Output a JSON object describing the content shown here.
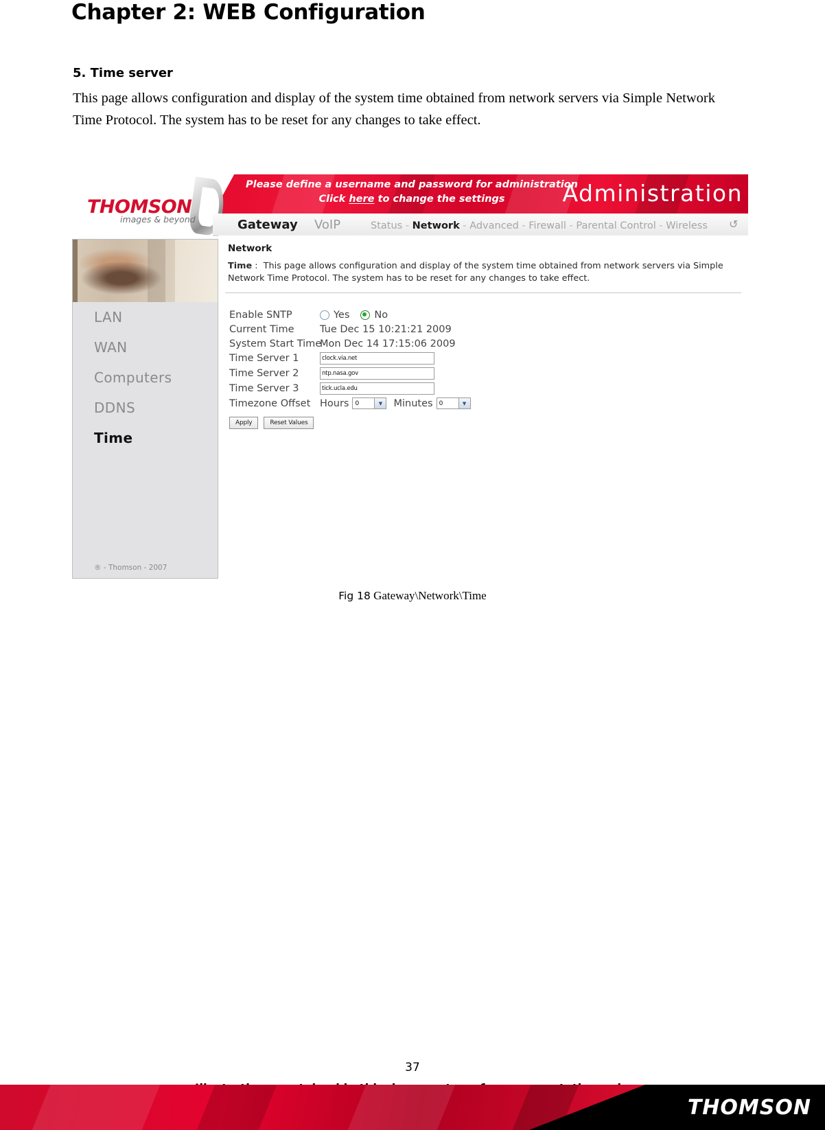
{
  "document": {
    "chapter_title": "Chapter 2: WEB Configuration",
    "section_heading": "5. Time server",
    "body_paragraph": "This page allows configuration and display of the system time obtained from network servers via Simple Network Time Protocol. The system has to be reset for any changes to take effect.",
    "figure_label": "Fig 18",
    "figure_caption": "Gateway\\Network\\Time",
    "page_number": "37",
    "footer_note": "Illustrations contained in this document are for representation only.",
    "footer_brand": "THOMSON"
  },
  "screenshot": {
    "brand": {
      "name": "THOMSON",
      "tagline": "images & beyond"
    },
    "header": {
      "notice_line1": "Please define a username and password for administration",
      "notice_line2_pre": "Click ",
      "notice_link": "here",
      "notice_line2_post": " to change the settings",
      "title": "Administration",
      "accent_color": "#e30b2d"
    },
    "nav": {
      "primary": [
        "Gateway",
        "VoIP"
      ],
      "primary_active": "Gateway",
      "secondary": [
        "Status",
        "Network",
        "Advanced",
        "Firewall",
        "Parental Control",
        "Wireless"
      ],
      "secondary_active": "Network",
      "refresh_icon": "refresh-icon"
    },
    "sidebar": {
      "items": [
        {
          "label": "LAN",
          "active": false
        },
        {
          "label": "WAN",
          "active": false
        },
        {
          "label": "Computers",
          "active": false
        },
        {
          "label": "DDNS",
          "active": false
        },
        {
          "label": "Time",
          "active": true
        }
      ],
      "copyright": "® - Thomson - 2007"
    },
    "content": {
      "breadcrumb": "Network",
      "desc_label": "Time",
      "desc_sep": ":",
      "description": "This page allows configuration and display of the system time obtained from network servers via Simple Network Time Protocol. The system has to be reset for any changes to take effect.",
      "form": {
        "enable_sntp": {
          "label": "Enable SNTP",
          "yes_label": "Yes",
          "no_label": "No",
          "selected": "No"
        },
        "current_time": {
          "label": "Current Time",
          "value": "Tue Dec 15 10:21:21 2009"
        },
        "system_start_time": {
          "label": "System Start Time",
          "value": "Mon Dec 14 17:15:06 2009"
        },
        "time_server_1": {
          "label": "Time Server 1",
          "value": "clock.via.net"
        },
        "time_server_2": {
          "label": "Time Server 2",
          "value": "ntp.nasa.gov"
        },
        "time_server_3": {
          "label": "Time Server 3",
          "value": "tick.ucla.edu"
        },
        "timezone_offset": {
          "label": "Timezone Offset",
          "hours_label": "Hours",
          "hours_value": "0",
          "minutes_label": "Minutes",
          "minutes_value": "0"
        },
        "apply_button": "Apply",
        "reset_button": "Reset Values"
      }
    }
  }
}
